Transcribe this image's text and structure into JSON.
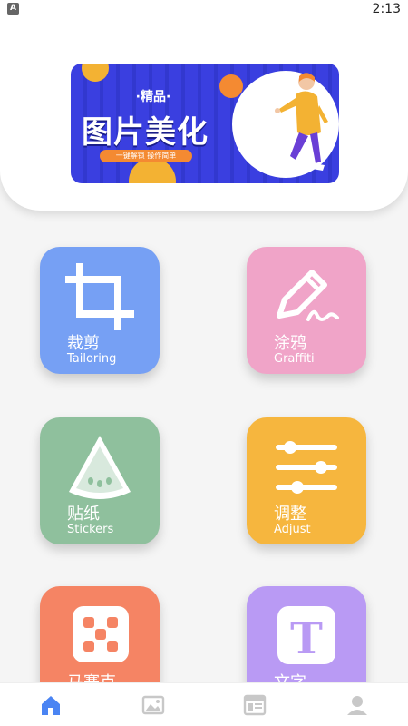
{
  "status": {
    "badge": "A",
    "time": "2:13"
  },
  "banner": {
    "badge": "·精品·",
    "title": "图片美化",
    "tagline": "一键解锁 操作简单"
  },
  "tiles": [
    {
      "name": "tailoring",
      "cn": "裁剪",
      "en": "Tailoring",
      "color": "#76a0f4",
      "icon": "crop-icon"
    },
    {
      "name": "graffiti",
      "cn": "涂鸦",
      "en": "Graffiti",
      "color": "#f0a4c8",
      "icon": "pen-icon"
    },
    {
      "name": "stickers",
      "cn": "贴纸",
      "en": "Stickers",
      "color": "#8fc09d",
      "icon": "watermelon-icon"
    },
    {
      "name": "adjust",
      "cn": "调整",
      "en": "Adjust",
      "color": "#f6b63e",
      "icon": "sliders-icon"
    },
    {
      "name": "mosaic",
      "cn": "马赛克",
      "en": "",
      "color": "#f58464",
      "icon": "mosaic-icon"
    },
    {
      "name": "text",
      "cn": "文字",
      "en": "",
      "color": "#b99af4",
      "icon": "text-icon"
    }
  ],
  "tabbar": {
    "items": [
      "home-icon",
      "image-icon",
      "template-icon",
      "user-icon"
    ],
    "active_color": "#4a84f3",
    "inactive_color": "#c8c8c8"
  }
}
